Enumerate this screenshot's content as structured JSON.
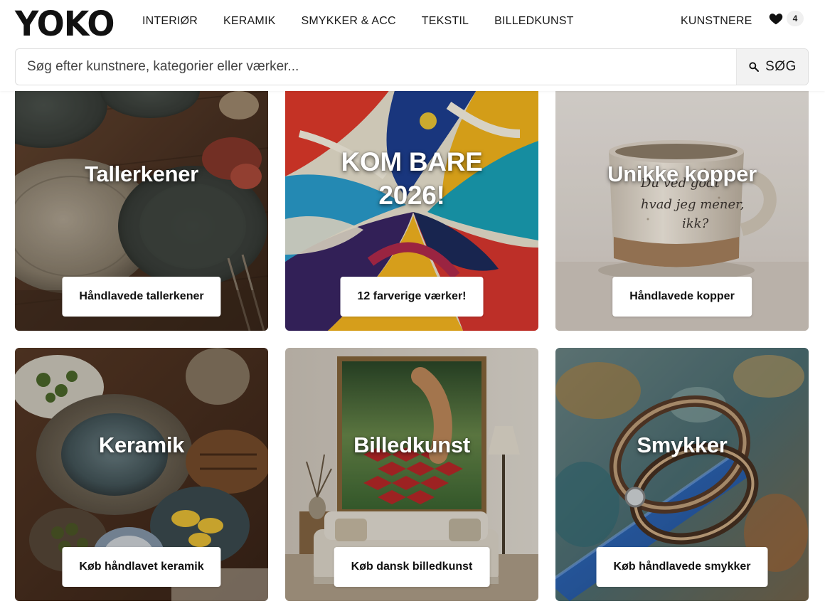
{
  "brand": {
    "logo_text": "YOKO"
  },
  "nav": {
    "items": [
      {
        "label": "INTERIØR"
      },
      {
        "label": "KERAMIK"
      },
      {
        "label": "SMYKKER & ACC"
      },
      {
        "label": "TEKSTIL"
      },
      {
        "label": "BILLEDKUNST"
      }
    ],
    "artists_label": "KUNSTNERE",
    "favorites": {
      "icon": "heart-icon",
      "count": "4"
    }
  },
  "search": {
    "placeholder": "Søg efter kunstnere, kategorier eller værker...",
    "value": "",
    "button_label": "SØG",
    "button_icon": "search-icon"
  },
  "cards": [
    {
      "title": "Tallerkener",
      "cta": "Håndlavede tallerkener"
    },
    {
      "title_line1": "KOM BARE",
      "title_line2": "2026!",
      "cta": "12 farverige værker!"
    },
    {
      "title": "Unikke kopper",
      "cta": "Håndlavede kopper"
    },
    {
      "title": "Keramik",
      "cta": "Køb håndlavet keramik"
    },
    {
      "title": "Billedkunst",
      "cta": "Køb dansk billedkunst"
    },
    {
      "title": "Smykker",
      "cta": "Køb håndlavede smykker"
    }
  ],
  "colors": {
    "header_bg": "#ffffff",
    "search_button_bg": "#f2f2f2",
    "text": "#111111",
    "badge_bg": "#f0f0f0"
  }
}
